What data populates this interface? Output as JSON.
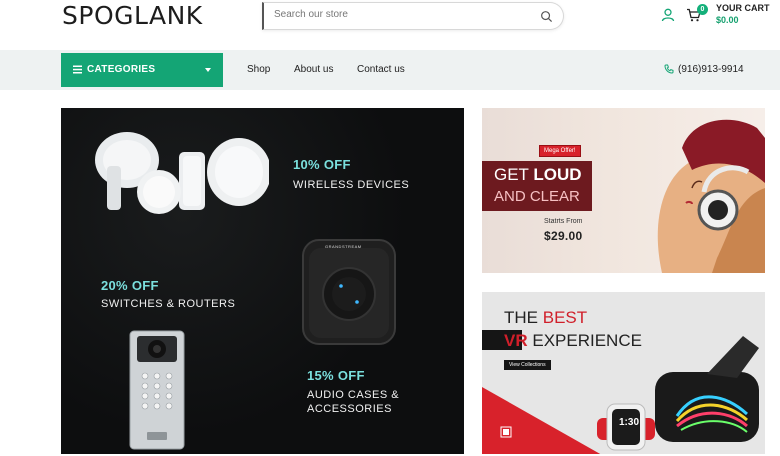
{
  "header": {
    "logo": "SPOGLANK",
    "search_placeholder": "Search our store",
    "cart_count": "0",
    "cart_label": "YOUR CART",
    "cart_total": "$0.00"
  },
  "nav": {
    "categories_label": "CATEGORIES",
    "links": [
      "Shop",
      "About us",
      "Contact us"
    ],
    "phone": "(916)913-9914"
  },
  "main_banner": {
    "offers": [
      {
        "title": "10% OFF",
        "subtitle": "WIRELESS DEVICES"
      },
      {
        "title": "20% OFF",
        "subtitle": "SWITCHES & ROUTERS"
      },
      {
        "title": "15% OFF",
        "subtitle": "AUDIO CASES &",
        "subtitle2": "ACCESSORIES"
      }
    ],
    "device_brand": "GRANDSTREAM"
  },
  "side_top": {
    "tag": "Mega Offer!",
    "line1_a": "GET",
    "line1_b": "LOUD",
    "line2": "AND CLEAR",
    "starts": "Statrts From",
    "price": "$29.00"
  },
  "side_bottom": {
    "line1_a": "THE",
    "line1_b": "BEST",
    "line2_a": "VR",
    "line2_b": "EXPERIENCE",
    "button": "View Collections",
    "watch_time": "1:30"
  },
  "colors": {
    "accent_green": "#14a575",
    "offer_teal": "#7be0de",
    "brand_red": "#d01f2a"
  }
}
